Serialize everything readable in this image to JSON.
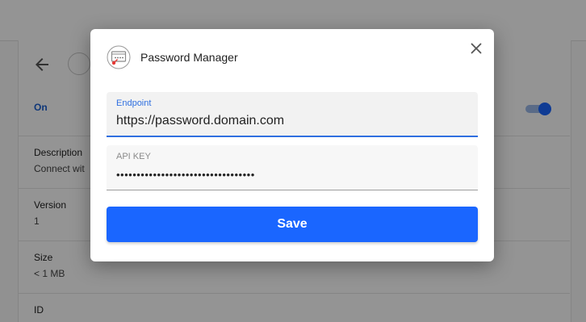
{
  "background": {
    "status": "On",
    "details": [
      {
        "label": "Description",
        "value": "Connect wit"
      },
      {
        "label": "Version",
        "value": "1"
      },
      {
        "label": "Size",
        "value": "< 1 MB"
      },
      {
        "label": "ID",
        "value": ""
      }
    ],
    "toggle_on": true
  },
  "dialog": {
    "title": "Password Manager",
    "app_icon": "password-manager-icon",
    "close_icon": "close-icon",
    "fields": {
      "endpoint": {
        "label": "Endpoint",
        "value": "https://password.domain.com"
      },
      "api_key": {
        "label": "API KEY",
        "value": "••••••••••••••••••••••••••••••••••"
      }
    },
    "save_label": "Save"
  },
  "colors": {
    "accent": "#1a66ff",
    "focus": "#2f6fe0",
    "scrim": "rgba(0,0,0,0.42)"
  }
}
